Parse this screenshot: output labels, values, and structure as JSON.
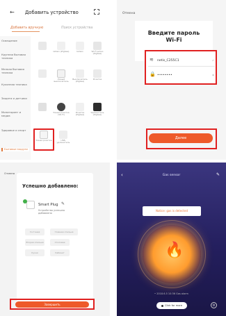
{
  "p1": {
    "title": "Добавить устройство",
    "tab_manual": "Добавить вручную",
    "tab_auto": "Поиск устройства",
    "categories": [
      "Освещение",
      "Крупная бытовая техника",
      "Мелкая бытовая техника",
      "Кухонная техника",
      "Защита и датчики",
      "Мониторинг и медиа",
      "Здоровье и спорт",
      "Бытовые модули"
    ],
    "devices": [
      {
        "label": "",
        "color": "#e8e8e8"
      },
      {
        "label": "Шлюз (Zigbee)",
        "color": "#f0f0f0"
      },
      {
        "label": "Шлюз",
        "color": "#f0f0f0"
      },
      {
        "label": "Wi-Fi шлюз (Zigbee)",
        "color": "#e6e6e6"
      },
      {
        "label": "",
        "color": "#ececec"
      },
      {
        "label": "Умный выключатель",
        "color": "#f2f2f2"
      },
      {
        "label": "Выключатель (Zigbee)",
        "color": "#eeeeee"
      },
      {
        "label": "Розетка",
        "color": "#eaeaea"
      },
      {
        "label": "",
        "color": "#e0e0e0"
      },
      {
        "label": "Умная розетка (Wi-Fi)",
        "color": "#444444"
      },
      {
        "label": "Розетка (Zigbee)",
        "color": "#f0f0f0"
      },
      {
        "label": "Удлинитель (Zigbee)",
        "color": "#2d2d2d"
      },
      {
        "label": "Умная розетка",
        "color": "#f5f5f5"
      },
      {
        "label": "USB-удлинитель",
        "color": "#ededed"
      }
    ]
  },
  "p2": {
    "cancel": "Отмена",
    "prompt_line1": "Введите пароль",
    "prompt_line2": "Wi-Fi",
    "ssid": "netis_C255C1",
    "password": "••••••••",
    "next_button": "Далее"
  },
  "p3": {
    "header": "Отмена",
    "success": "Успешно добавлено:",
    "device_name": "Smart Plug",
    "device_sub": "Устройство успешно добавлено",
    "rooms": [
      "Гостиная",
      "Главная спальня",
      "Вторая спальня",
      "Столовая",
      "Кухня",
      "Кабинет"
    ],
    "done_button": "Завершить"
  },
  "p4": {
    "title": "Gas sensor",
    "alert": "Notice: gas is detected",
    "log": "• 2018.6.5 10:36 Gas alarm",
    "more": "Click for more"
  },
  "colors": {
    "accent": "#ee5a2a",
    "highlight": "#e02020",
    "purple": "#2b2668"
  }
}
